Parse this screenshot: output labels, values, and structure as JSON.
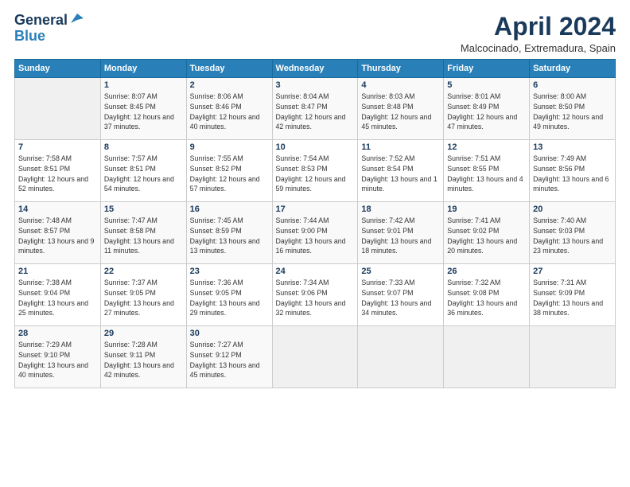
{
  "logo": {
    "line1": "General",
    "line2": "Blue"
  },
  "title": "April 2024",
  "subtitle": "Malcocinado, Extremadura, Spain",
  "days_of_week": [
    "Sunday",
    "Monday",
    "Tuesday",
    "Wednesday",
    "Thursday",
    "Friday",
    "Saturday"
  ],
  "weeks": [
    [
      {
        "day": "",
        "info": ""
      },
      {
        "day": "1",
        "info": "Sunrise: 8:07 AM\nSunset: 8:45 PM\nDaylight: 12 hours\nand 37 minutes."
      },
      {
        "day": "2",
        "info": "Sunrise: 8:06 AM\nSunset: 8:46 PM\nDaylight: 12 hours\nand 40 minutes."
      },
      {
        "day": "3",
        "info": "Sunrise: 8:04 AM\nSunset: 8:47 PM\nDaylight: 12 hours\nand 42 minutes."
      },
      {
        "day": "4",
        "info": "Sunrise: 8:03 AM\nSunset: 8:48 PM\nDaylight: 12 hours\nand 45 minutes."
      },
      {
        "day": "5",
        "info": "Sunrise: 8:01 AM\nSunset: 8:49 PM\nDaylight: 12 hours\nand 47 minutes."
      },
      {
        "day": "6",
        "info": "Sunrise: 8:00 AM\nSunset: 8:50 PM\nDaylight: 12 hours\nand 49 minutes."
      }
    ],
    [
      {
        "day": "7",
        "info": "Sunrise: 7:58 AM\nSunset: 8:51 PM\nDaylight: 12 hours\nand 52 minutes."
      },
      {
        "day": "8",
        "info": "Sunrise: 7:57 AM\nSunset: 8:51 PM\nDaylight: 12 hours\nand 54 minutes."
      },
      {
        "day": "9",
        "info": "Sunrise: 7:55 AM\nSunset: 8:52 PM\nDaylight: 12 hours\nand 57 minutes."
      },
      {
        "day": "10",
        "info": "Sunrise: 7:54 AM\nSunset: 8:53 PM\nDaylight: 12 hours\nand 59 minutes."
      },
      {
        "day": "11",
        "info": "Sunrise: 7:52 AM\nSunset: 8:54 PM\nDaylight: 13 hours\nand 1 minute."
      },
      {
        "day": "12",
        "info": "Sunrise: 7:51 AM\nSunset: 8:55 PM\nDaylight: 13 hours\nand 4 minutes."
      },
      {
        "day": "13",
        "info": "Sunrise: 7:49 AM\nSunset: 8:56 PM\nDaylight: 13 hours\nand 6 minutes."
      }
    ],
    [
      {
        "day": "14",
        "info": "Sunrise: 7:48 AM\nSunset: 8:57 PM\nDaylight: 13 hours\nand 9 minutes."
      },
      {
        "day": "15",
        "info": "Sunrise: 7:47 AM\nSunset: 8:58 PM\nDaylight: 13 hours\nand 11 minutes."
      },
      {
        "day": "16",
        "info": "Sunrise: 7:45 AM\nSunset: 8:59 PM\nDaylight: 13 hours\nand 13 minutes."
      },
      {
        "day": "17",
        "info": "Sunrise: 7:44 AM\nSunset: 9:00 PM\nDaylight: 13 hours\nand 16 minutes."
      },
      {
        "day": "18",
        "info": "Sunrise: 7:42 AM\nSunset: 9:01 PM\nDaylight: 13 hours\nand 18 minutes."
      },
      {
        "day": "19",
        "info": "Sunrise: 7:41 AM\nSunset: 9:02 PM\nDaylight: 13 hours\nand 20 minutes."
      },
      {
        "day": "20",
        "info": "Sunrise: 7:40 AM\nSunset: 9:03 PM\nDaylight: 13 hours\nand 23 minutes."
      }
    ],
    [
      {
        "day": "21",
        "info": "Sunrise: 7:38 AM\nSunset: 9:04 PM\nDaylight: 13 hours\nand 25 minutes."
      },
      {
        "day": "22",
        "info": "Sunrise: 7:37 AM\nSunset: 9:05 PM\nDaylight: 13 hours\nand 27 minutes."
      },
      {
        "day": "23",
        "info": "Sunrise: 7:36 AM\nSunset: 9:05 PM\nDaylight: 13 hours\nand 29 minutes."
      },
      {
        "day": "24",
        "info": "Sunrise: 7:34 AM\nSunset: 9:06 PM\nDaylight: 13 hours\nand 32 minutes."
      },
      {
        "day": "25",
        "info": "Sunrise: 7:33 AM\nSunset: 9:07 PM\nDaylight: 13 hours\nand 34 minutes."
      },
      {
        "day": "26",
        "info": "Sunrise: 7:32 AM\nSunset: 9:08 PM\nDaylight: 13 hours\nand 36 minutes."
      },
      {
        "day": "27",
        "info": "Sunrise: 7:31 AM\nSunset: 9:09 PM\nDaylight: 13 hours\nand 38 minutes."
      }
    ],
    [
      {
        "day": "28",
        "info": "Sunrise: 7:29 AM\nSunset: 9:10 PM\nDaylight: 13 hours\nand 40 minutes."
      },
      {
        "day": "29",
        "info": "Sunrise: 7:28 AM\nSunset: 9:11 PM\nDaylight: 13 hours\nand 42 minutes."
      },
      {
        "day": "30",
        "info": "Sunrise: 7:27 AM\nSunset: 9:12 PM\nDaylight: 13 hours\nand 45 minutes."
      },
      {
        "day": "",
        "info": ""
      },
      {
        "day": "",
        "info": ""
      },
      {
        "day": "",
        "info": ""
      },
      {
        "day": "",
        "info": ""
      }
    ]
  ]
}
